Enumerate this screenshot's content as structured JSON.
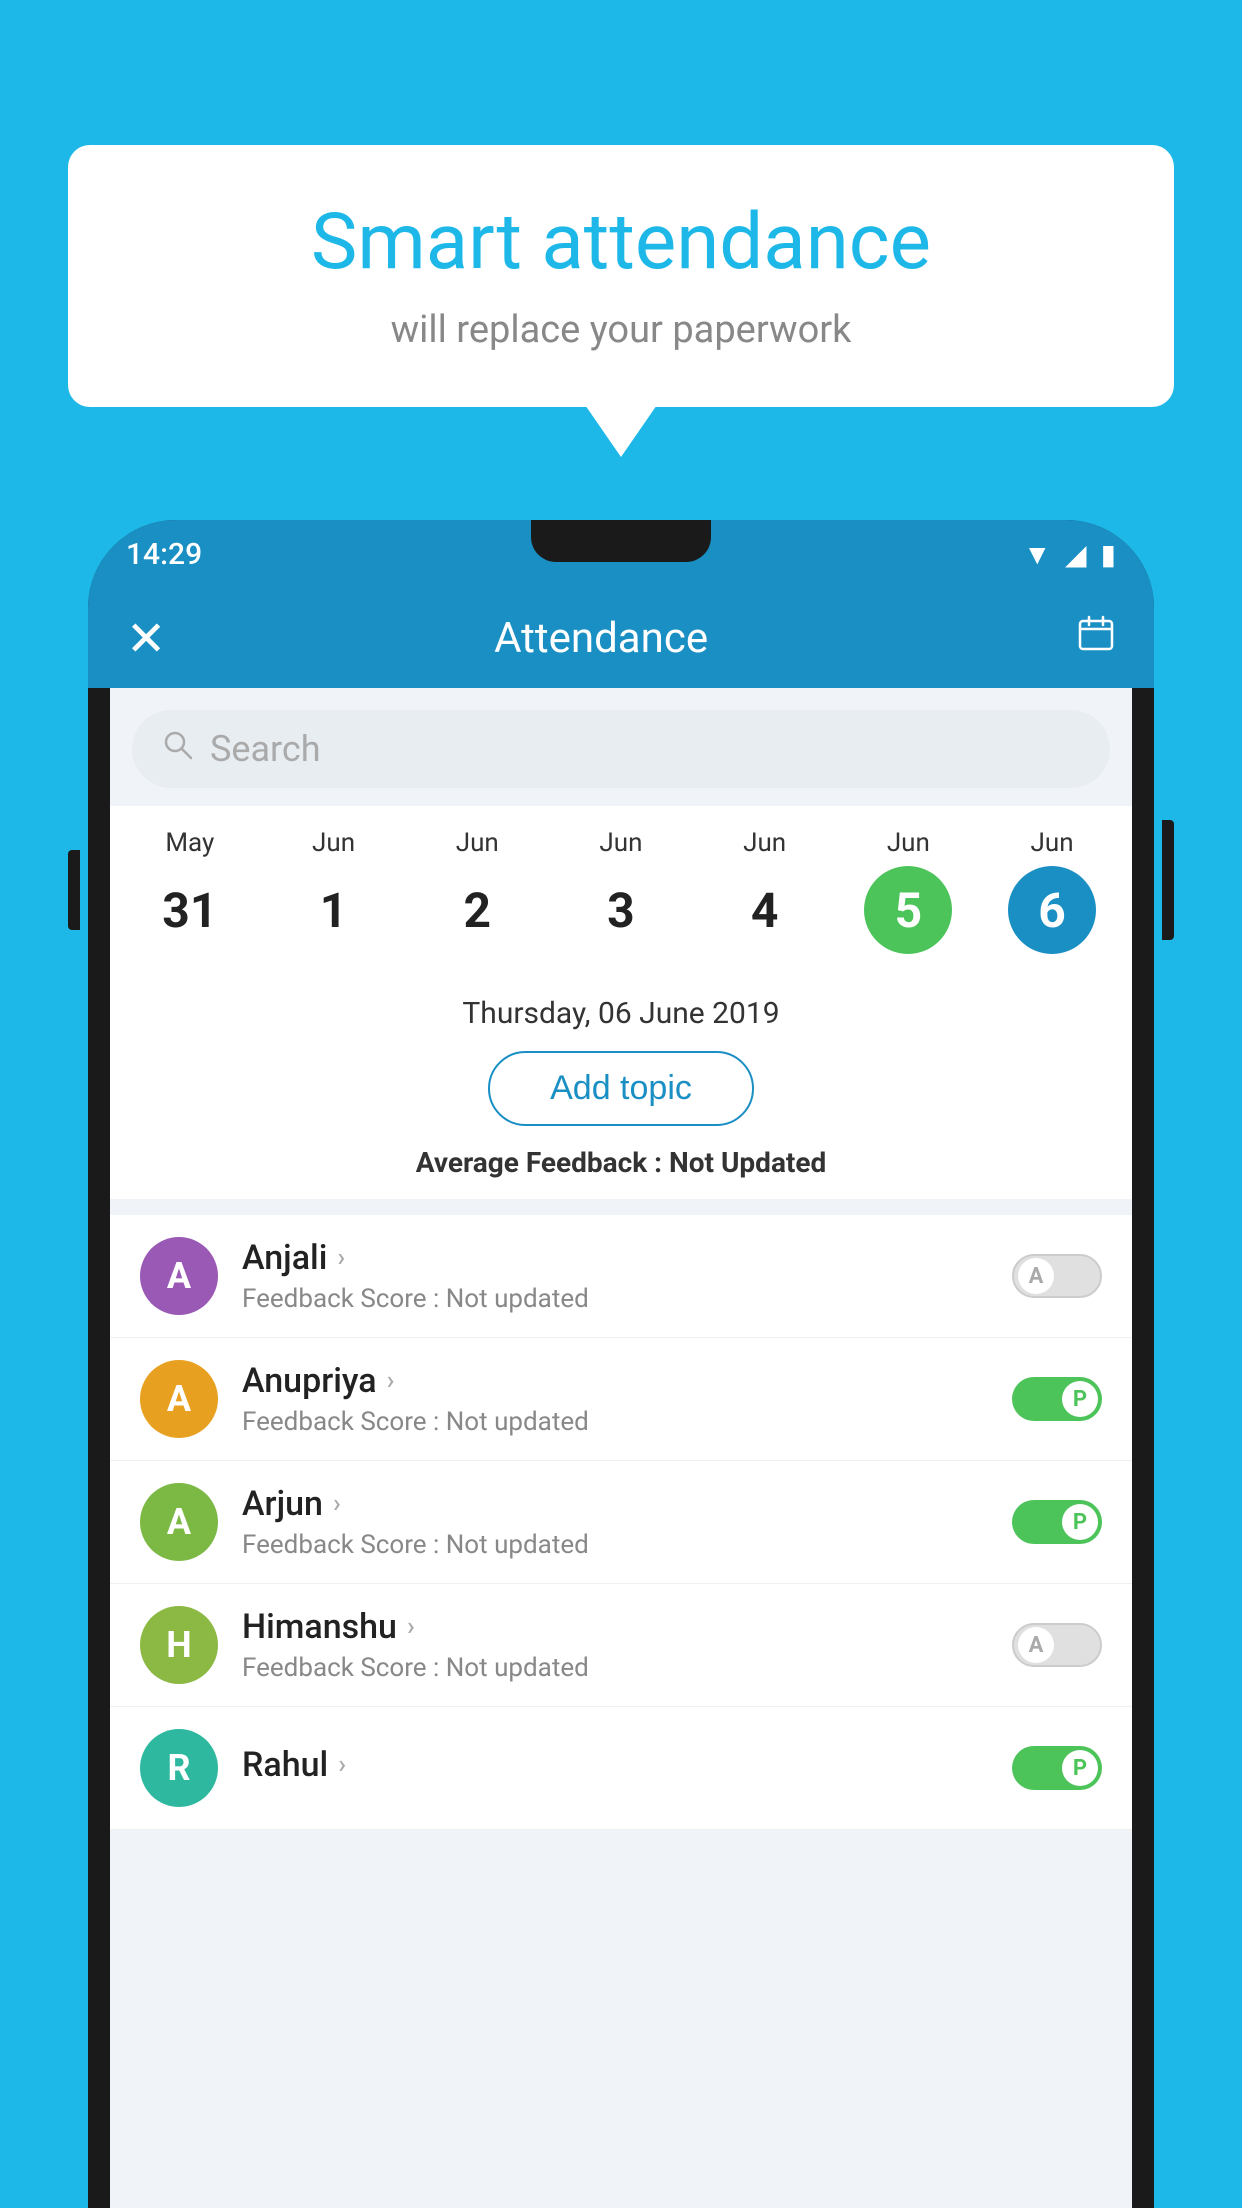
{
  "background": "#1db8e8",
  "bubble": {
    "title": "Smart attendance",
    "subtitle": "will replace your paperwork"
  },
  "status_bar": {
    "time": "14:29",
    "wifi": "▼",
    "signal": "▲",
    "battery": "▮"
  },
  "app_bar": {
    "title": "Attendance",
    "close_label": "✕",
    "calendar_label": "📅"
  },
  "search": {
    "placeholder": "Search"
  },
  "calendar": {
    "dates": [
      {
        "month": "May",
        "day": "31",
        "style": "normal"
      },
      {
        "month": "Jun",
        "day": "1",
        "style": "normal"
      },
      {
        "month": "Jun",
        "day": "2",
        "style": "normal"
      },
      {
        "month": "Jun",
        "day": "3",
        "style": "normal"
      },
      {
        "month": "Jun",
        "day": "4",
        "style": "normal"
      },
      {
        "month": "Jun",
        "day": "5",
        "style": "today"
      },
      {
        "month": "Jun",
        "day": "6",
        "style": "selected"
      }
    ],
    "selected_date": "Thursday, 06 June 2019"
  },
  "add_topic_label": "Add topic",
  "average_feedback": {
    "label": "Average Feedback :",
    "value": "Not Updated"
  },
  "students": [
    {
      "name": "Anjali",
      "feedback": "Feedback Score : Not updated",
      "avatar_letter": "A",
      "avatar_color": "purple",
      "toggle": "off",
      "toggle_letter": "A"
    },
    {
      "name": "Anupriya",
      "feedback": "Feedback Score : Not updated",
      "avatar_letter": "A",
      "avatar_color": "orange",
      "toggle": "on",
      "toggle_letter": "P"
    },
    {
      "name": "Arjun",
      "feedback": "Feedback Score : Not updated",
      "avatar_letter": "A",
      "avatar_color": "green",
      "toggle": "on",
      "toggle_letter": "P"
    },
    {
      "name": "Himanshu",
      "feedback": "Feedback Score : Not updated",
      "avatar_letter": "H",
      "avatar_color": "olive",
      "toggle": "off",
      "toggle_letter": "A"
    },
    {
      "name": "Rahul",
      "feedback": "",
      "avatar_letter": "R",
      "avatar_color": "teal",
      "toggle": "on",
      "toggle_letter": "P"
    }
  ]
}
